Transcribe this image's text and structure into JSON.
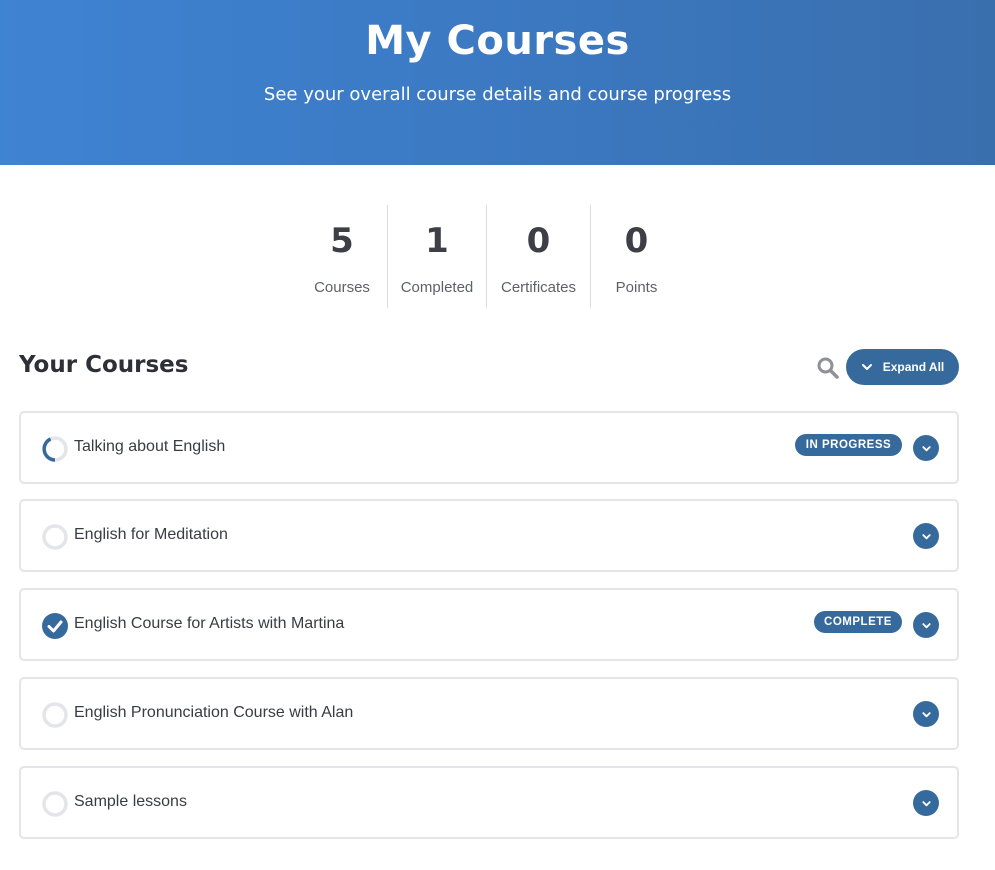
{
  "header": {
    "title": "My Courses",
    "subtitle": "See your overall course details and course progress"
  },
  "stats": [
    {
      "value": "5",
      "label": "Courses"
    },
    {
      "value": "1",
      "label": "Completed"
    },
    {
      "value": "0",
      "label": "Certificates"
    },
    {
      "value": "0",
      "label": "Points"
    }
  ],
  "section": {
    "title": "Your Courses",
    "expand_label": "Expand All",
    "search_icon": "search-icon"
  },
  "courses": [
    {
      "title": "Talking about English",
      "status": "in-progress",
      "badge": "IN PROGRESS"
    },
    {
      "title": "English for Meditation",
      "status": "not-started",
      "badge": ""
    },
    {
      "title": "English Course for Artists with Martina",
      "status": "complete",
      "badge": "COMPLETE"
    },
    {
      "title": "English Pronunciation Course with Alan",
      "status": "not-started",
      "badge": ""
    },
    {
      "title": "Sample lessons",
      "status": "not-started",
      "badge": ""
    }
  ],
  "colors": {
    "accent": "#376a9c",
    "hero_start": "#3f83d3",
    "hero_end": "#3a6fae",
    "ring_empty": "#e3e5ea"
  }
}
